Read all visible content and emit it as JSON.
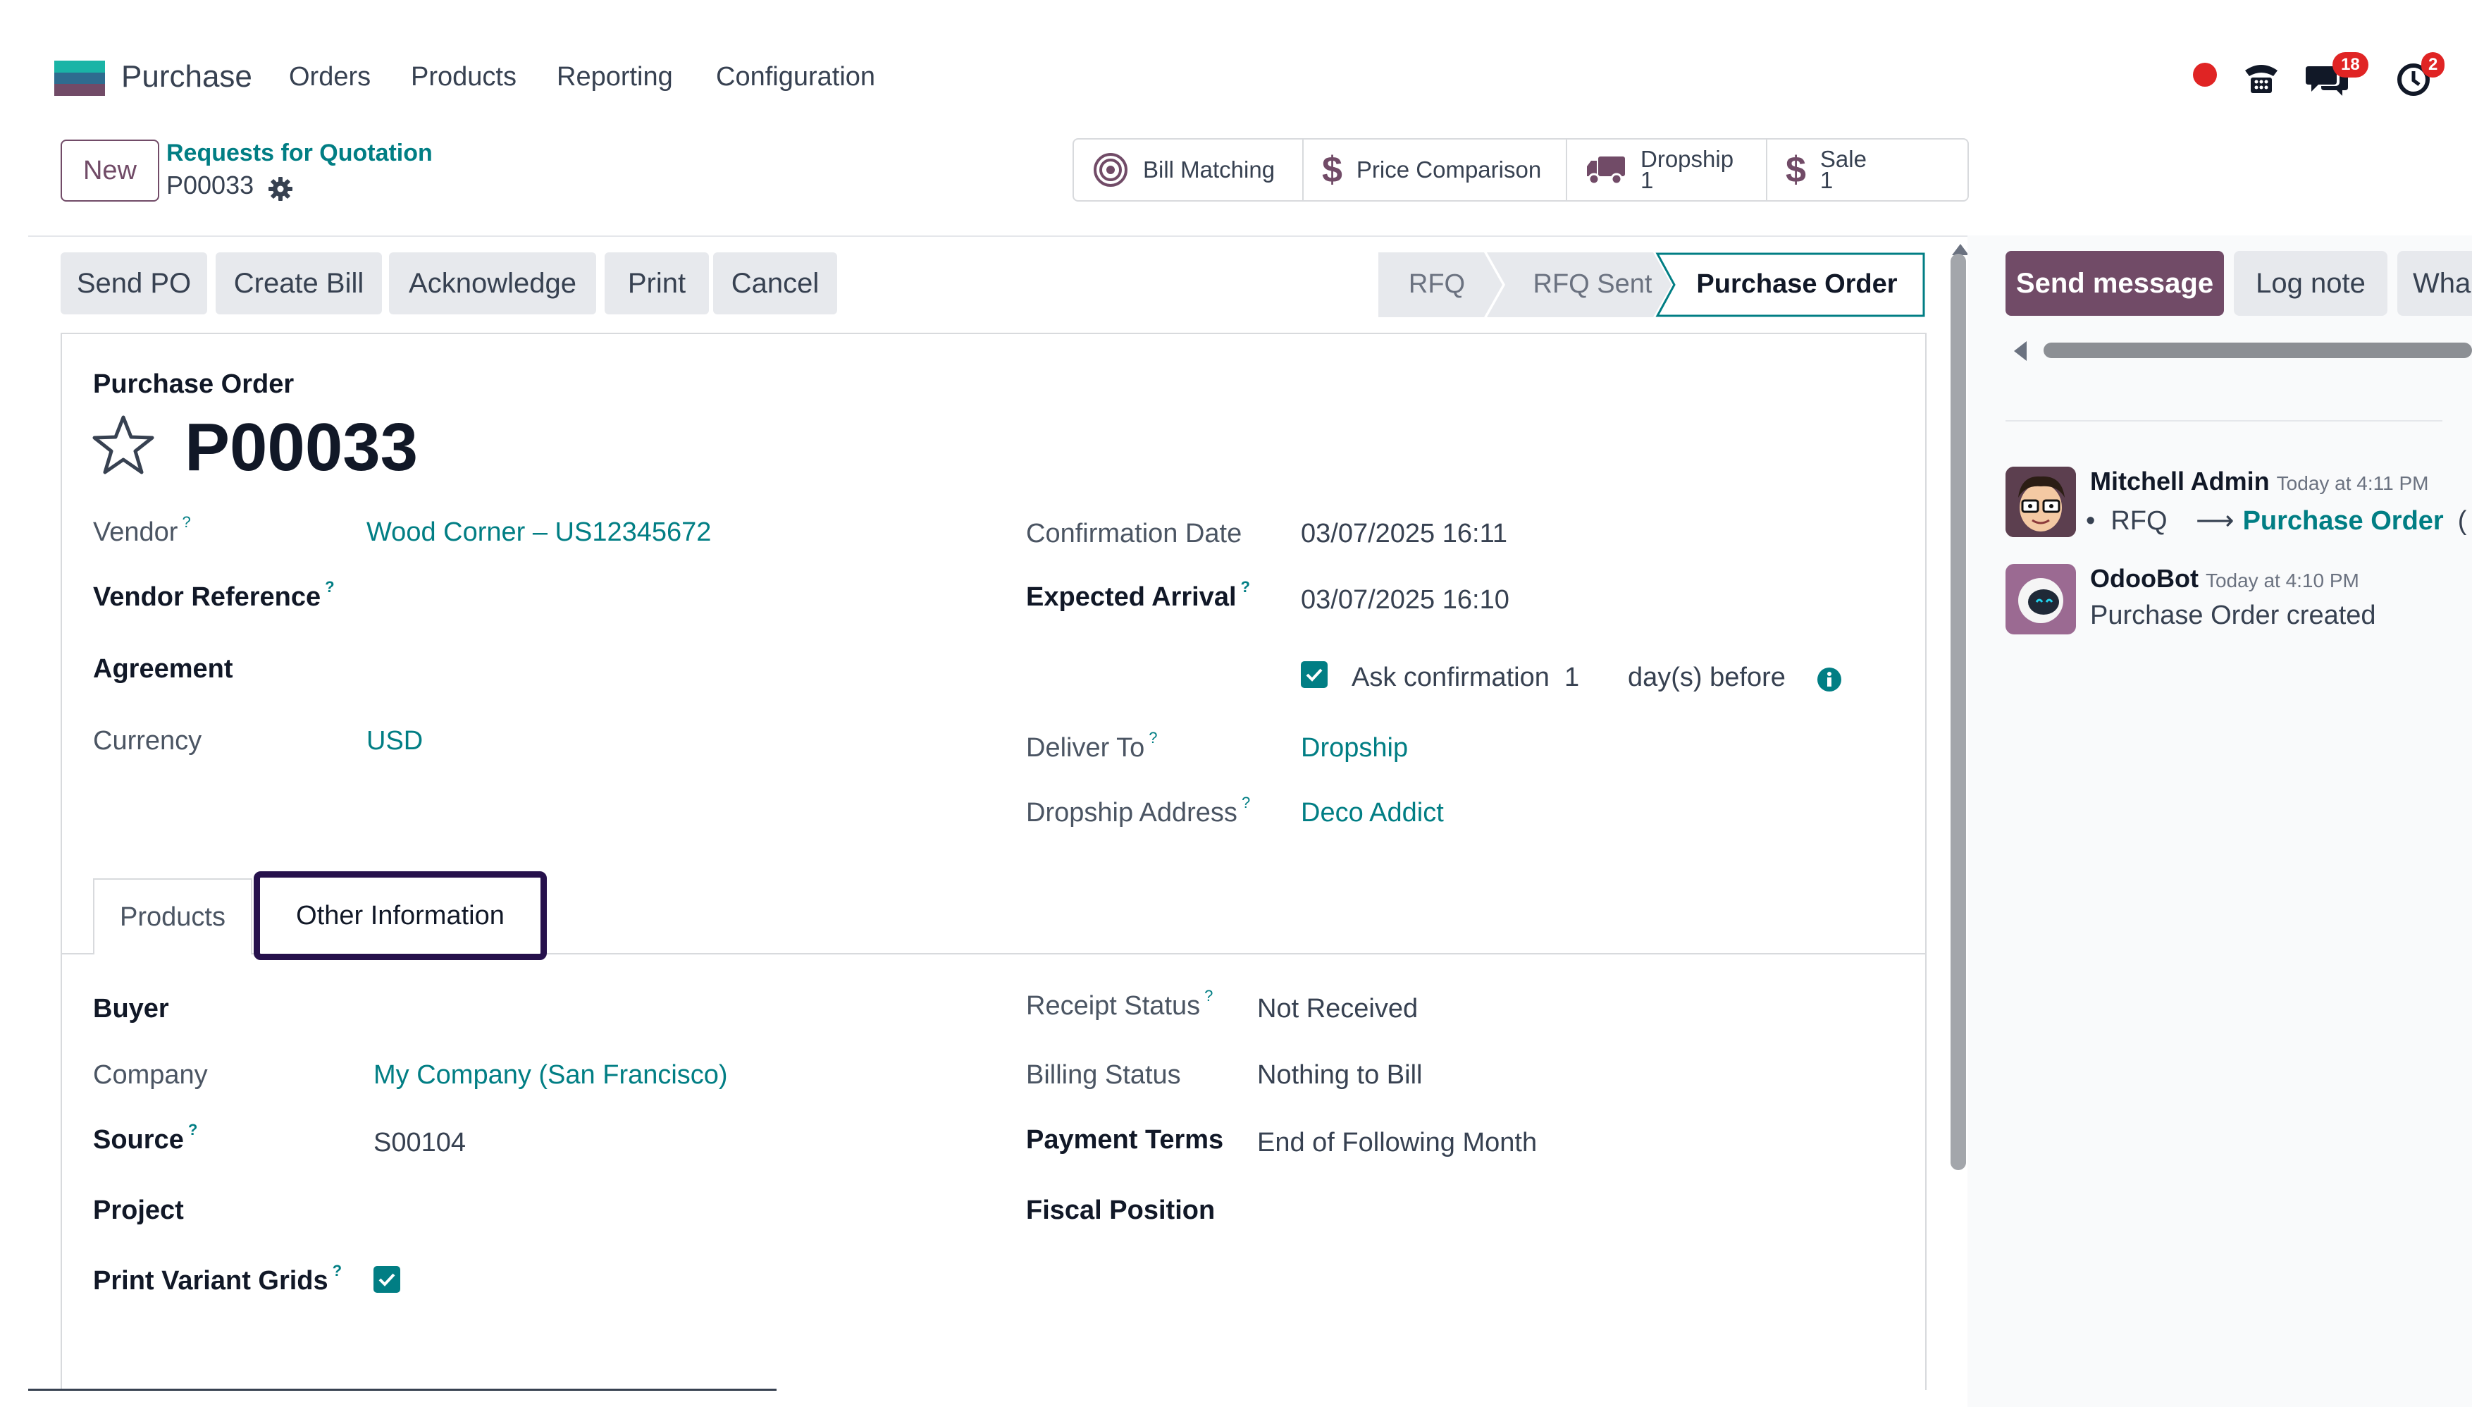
{
  "nav": {
    "app_name": "Purchase",
    "menu": [
      "Orders",
      "Products",
      "Reporting",
      "Configuration"
    ],
    "badges": {
      "messages": "18",
      "activities": "2"
    }
  },
  "control_panel": {
    "new_label": "New",
    "breadcrumb_parent": "Requests for Quotation",
    "breadcrumb_current": "P00033"
  },
  "smart_buttons": [
    {
      "label": "Bill Matching",
      "icon": "target-icon"
    },
    {
      "label": "Price Comparison",
      "icon": "dollar-icon"
    },
    {
      "label": "Dropship",
      "count": "1",
      "icon": "truck-icon"
    },
    {
      "label": "Sale",
      "count": "1",
      "icon": "dollar-icon"
    }
  ],
  "actions": [
    "Send PO",
    "Create Bill",
    "Acknowledge",
    "Print",
    "Cancel"
  ],
  "stages": {
    "items": [
      "RFQ",
      "RFQ Sent",
      "Purchase Order"
    ],
    "current": "Purchase Order"
  },
  "form": {
    "doc_type": "Purchase Order",
    "name": "P00033",
    "left": {
      "vendor_label": "Vendor",
      "vendor_value": "Wood Corner – US12345672",
      "vendor_ref_label": "Vendor Reference",
      "agreement_label": "Agreement",
      "currency_label": "Currency",
      "currency_value": "USD"
    },
    "right": {
      "confirmation_date_label": "Confirmation Date",
      "confirmation_date_value": "03/07/2025 16:11",
      "expected_arrival_label": "Expected Arrival",
      "expected_arrival_value": "03/07/2025 16:10",
      "ask_confirmation_label": "Ask confirmation",
      "ask_confirmation_days": "1",
      "ask_confirmation_suffix": "day(s) before",
      "ask_confirmation_checked": true,
      "deliver_to_label": "Deliver To",
      "deliver_to_value": "Dropship",
      "dropship_address_label": "Dropship Address",
      "dropship_address_value": "Deco Addict"
    },
    "tabs": [
      "Products",
      "Other Information"
    ],
    "active_tab": "Other Information",
    "other_info": {
      "buyer_label": "Buyer",
      "company_label": "Company",
      "company_value": "My Company (San Francisco)",
      "source_label": "Source",
      "source_value": "S00104",
      "project_label": "Project",
      "print_variant_label": "Print Variant Grids",
      "print_variant_checked": true,
      "receipt_status_label": "Receipt Status",
      "receipt_status_value": "Not Received",
      "billing_status_label": "Billing Status",
      "billing_status_value": "Nothing to Bill",
      "payment_terms_label": "Payment Terms",
      "payment_terms_value": "End of Following Month",
      "fiscal_position_label": "Fiscal Position"
    }
  },
  "chatter": {
    "send_message": "Send message",
    "log_note": "Log note",
    "whatsapp": "Wha",
    "messages": [
      {
        "author": "Mitchell Admin",
        "time": "Today at 4:11 PM",
        "from": "RFQ",
        "to": "Purchase Order"
      },
      {
        "author": "OdooBot",
        "time": "Today at 4:10 PM",
        "body": "Purchase Order created"
      }
    ]
  },
  "colors": {
    "brand": "#714b67",
    "link": "#017e84",
    "highlight_box": "#26114c",
    "badge": "#e02424"
  }
}
